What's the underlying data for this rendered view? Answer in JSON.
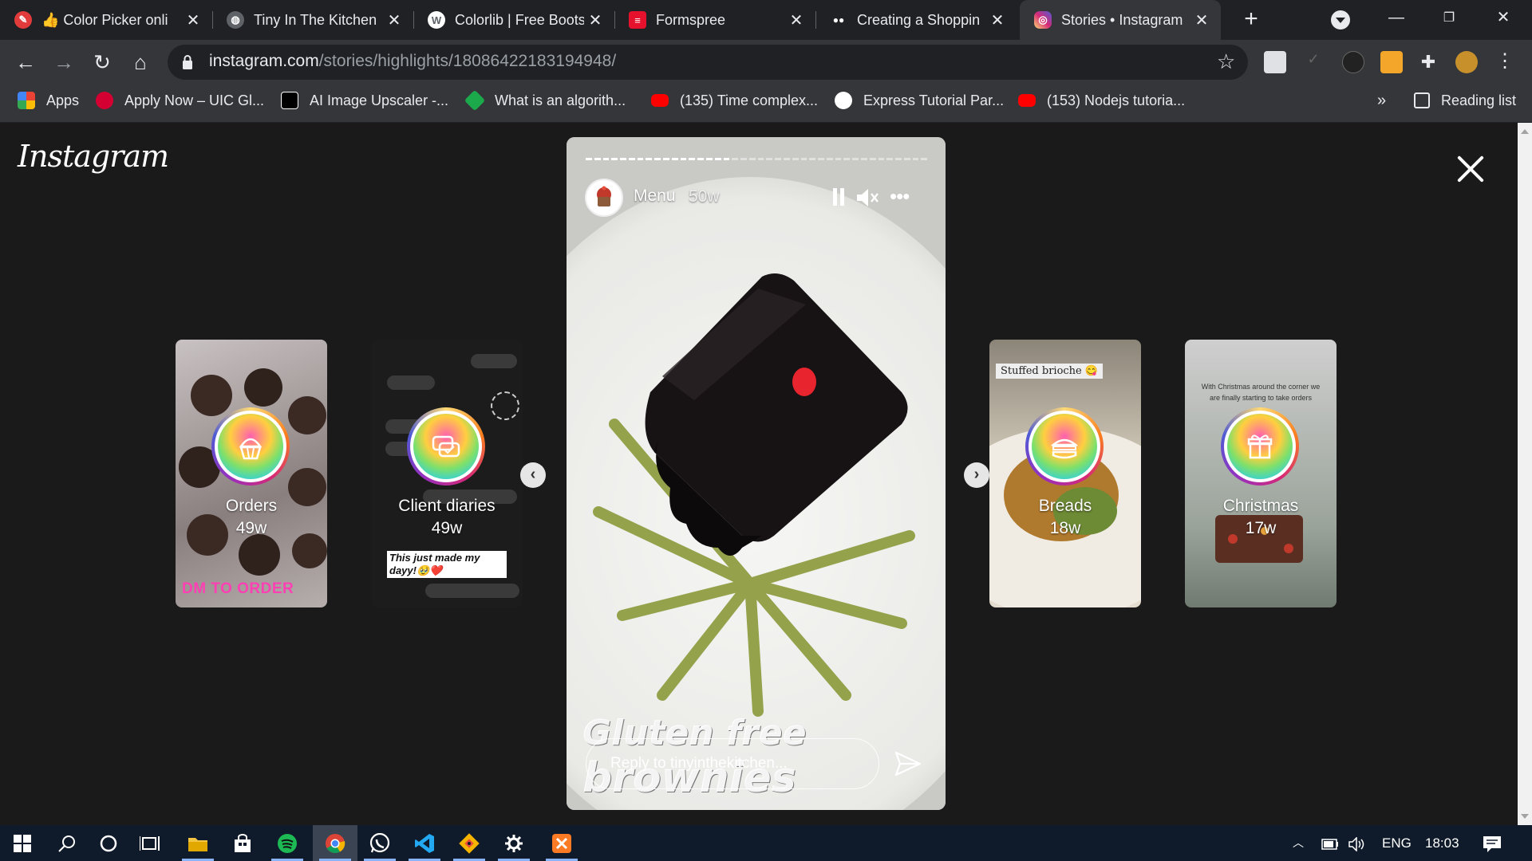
{
  "browser": {
    "tabs": [
      {
        "title": "👍 Color Picker onli",
        "favicon_color": "#e23b3b",
        "favicon_glyph": "✎"
      },
      {
        "title": "Tiny In The Kitchen",
        "favicon_color": "#5f6368",
        "favicon_glyph": "◍"
      },
      {
        "title": "Colorlib | Free Boots",
        "favicon_color": "#5f6368",
        "favicon_glyph": "W"
      },
      {
        "title": "Formspree",
        "favicon_color": "#e5112d",
        "favicon_glyph": "≡"
      },
      {
        "title": "Creating a Shoppin",
        "favicon_color": "#202124",
        "favicon_glyph": "●●"
      },
      {
        "title": "Stories • Instagram",
        "favicon_color": "#d62976",
        "favicon_glyph": "◎"
      }
    ],
    "url_host": "instagram.com",
    "url_path": "/stories/highlights/18086422183194948/",
    "bookmarks": [
      {
        "label": "Apps",
        "color": "#4285f4"
      },
      {
        "label": "Apply Now – UIC Gl...",
        "color": "#d50032"
      },
      {
        "label": "AI Image Upscaler -...",
        "color": "#000000"
      },
      {
        "label": "What is an algorith...",
        "color": "#1ba94c"
      },
      {
        "label": "(135) Time complex...",
        "color": "#ff0000"
      },
      {
        "label": "Express Tutorial Par...",
        "color": "#000000"
      },
      {
        "label": "(153) Nodejs tutoria...",
        "color": "#ff0000"
      }
    ],
    "reading_list": "Reading list",
    "overflow": "»"
  },
  "instagram": {
    "logo": "Instagram",
    "highlights": [
      {
        "name": "Orders",
        "age": "49w",
        "icon": "cupcake-icon",
        "bg": "#9d9696",
        "caption": "DM TO ORDER"
      },
      {
        "name": "Client diaries",
        "age": "49w",
        "icon": "chat-icon",
        "bg": "#1c1c1c",
        "caption": "This just made my dayy!🥹❤️"
      },
      {
        "name": "Breads",
        "age": "18w",
        "icon": "sandwich-icon",
        "bg": "#c9b58f",
        "caption": "Stuffed brioche 😋"
      },
      {
        "name": "Christmas",
        "age": "17w",
        "icon": "gift-icon",
        "bg": "#b8b8b8",
        "caption": "With Christmas around the corner we are finally starting to take orders"
      }
    ],
    "story": {
      "name": "Menu",
      "age": "50w",
      "caption_line1": "Gluten free",
      "caption_line2": "brownies",
      "reply_placeholder": "Reply to tinyinthekitchen...",
      "progress_done": 0.42
    }
  },
  "taskbar": {
    "language": "ENG",
    "time": "18:03"
  }
}
